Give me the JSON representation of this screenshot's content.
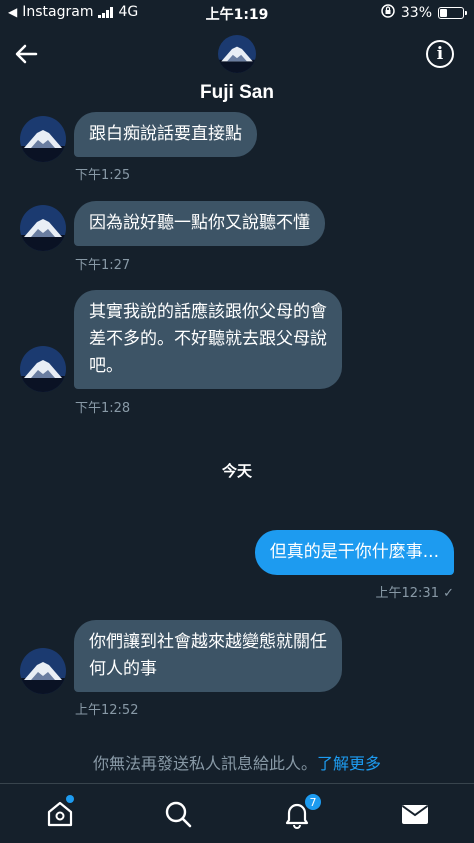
{
  "status_bar": {
    "carrier": "Instagram",
    "network": "4G",
    "time": "上午1:19",
    "battery": "33%",
    "battery_level": 0.33
  },
  "header": {
    "name": "Fuji San"
  },
  "messages": [
    {
      "direction": "in",
      "text": "跟白痴說話要直接點",
      "time": "下午1:25"
    },
    {
      "direction": "in",
      "text": "因為說好聽一點你又說聽不懂",
      "time": "下午1:27"
    },
    {
      "direction": "in",
      "lines": [
        "其實我說的話應該跟你父母的會",
        "差不多的。不好聽就去跟父母說",
        "吧。"
      ],
      "time": "下午1:28"
    },
    {
      "direction": "out",
      "text": "但真的是干你什麼事...",
      "time": "上午12:31 ✓"
    },
    {
      "direction": "in",
      "lines": [
        "你們讓到社會越來越變態就關任",
        "何人的事"
      ],
      "time": "上午12:52"
    }
  ],
  "day_divider": "今天",
  "notice": {
    "text": "你無法再發送私人訊息給此人。",
    "link": "了解更多"
  },
  "tabs": {
    "notifications_badge": "7"
  },
  "colors": {
    "background": "#15202b",
    "incoming_bubble": "#3d5466",
    "outgoing_bubble": "#1d9bf0",
    "muted_text": "#8899a6"
  }
}
